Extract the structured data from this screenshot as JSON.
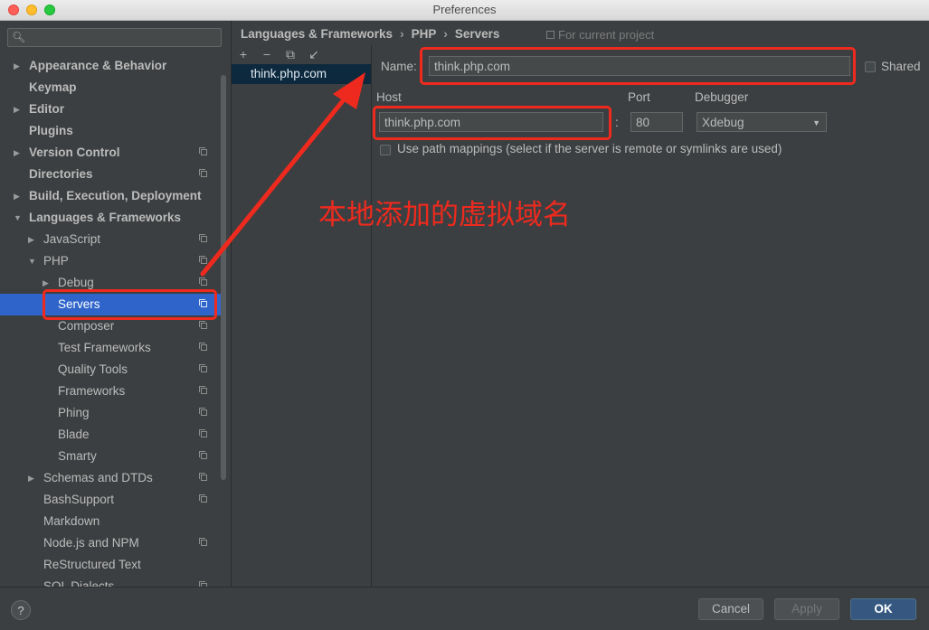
{
  "window": {
    "title": "Preferences"
  },
  "sidebar": {
    "search_placeholder": "",
    "items": [
      {
        "label": "Appearance & Behavior",
        "indent": 0,
        "arrow": "right",
        "bold": true,
        "project_icon": false,
        "selected": false
      },
      {
        "label": "Keymap",
        "indent": 0,
        "arrow": "",
        "bold": true,
        "project_icon": false,
        "selected": false
      },
      {
        "label": "Editor",
        "indent": 0,
        "arrow": "right",
        "bold": true,
        "project_icon": false,
        "selected": false
      },
      {
        "label": "Plugins",
        "indent": 0,
        "arrow": "",
        "bold": true,
        "project_icon": false,
        "selected": false
      },
      {
        "label": "Version Control",
        "indent": 0,
        "arrow": "right",
        "bold": true,
        "project_icon": true,
        "selected": false
      },
      {
        "label": "Directories",
        "indent": 0,
        "arrow": "",
        "bold": true,
        "project_icon": true,
        "selected": false
      },
      {
        "label": "Build, Execution, Deployment",
        "indent": 0,
        "arrow": "right",
        "bold": true,
        "project_icon": false,
        "selected": false
      },
      {
        "label": "Languages & Frameworks",
        "indent": 0,
        "arrow": "down",
        "bold": true,
        "project_icon": false,
        "selected": false
      },
      {
        "label": "JavaScript",
        "indent": 1,
        "arrow": "right",
        "bold": false,
        "project_icon": true,
        "selected": false
      },
      {
        "label": "PHP",
        "indent": 1,
        "arrow": "down",
        "bold": false,
        "project_icon": true,
        "selected": false
      },
      {
        "label": "Debug",
        "indent": 2,
        "arrow": "right",
        "bold": false,
        "project_icon": true,
        "selected": false
      },
      {
        "label": "Servers",
        "indent": 2,
        "arrow": "",
        "bold": false,
        "project_icon": true,
        "selected": true
      },
      {
        "label": "Composer",
        "indent": 2,
        "arrow": "",
        "bold": false,
        "project_icon": true,
        "selected": false
      },
      {
        "label": "Test Frameworks",
        "indent": 2,
        "arrow": "",
        "bold": false,
        "project_icon": true,
        "selected": false
      },
      {
        "label": "Quality Tools",
        "indent": 2,
        "arrow": "",
        "bold": false,
        "project_icon": true,
        "selected": false
      },
      {
        "label": "Frameworks",
        "indent": 2,
        "arrow": "",
        "bold": false,
        "project_icon": true,
        "selected": false
      },
      {
        "label": "Phing",
        "indent": 2,
        "arrow": "",
        "bold": false,
        "project_icon": true,
        "selected": false
      },
      {
        "label": "Blade",
        "indent": 2,
        "arrow": "",
        "bold": false,
        "project_icon": true,
        "selected": false
      },
      {
        "label": "Smarty",
        "indent": 2,
        "arrow": "",
        "bold": false,
        "project_icon": true,
        "selected": false
      },
      {
        "label": "Schemas and DTDs",
        "indent": 1,
        "arrow": "right",
        "bold": false,
        "project_icon": true,
        "selected": false
      },
      {
        "label": "BashSupport",
        "indent": 1,
        "arrow": "",
        "bold": false,
        "project_icon": true,
        "selected": false
      },
      {
        "label": "Markdown",
        "indent": 1,
        "arrow": "",
        "bold": false,
        "project_icon": false,
        "selected": false
      },
      {
        "label": "Node.js and NPM",
        "indent": 1,
        "arrow": "",
        "bold": false,
        "project_icon": true,
        "selected": false
      },
      {
        "label": "ReStructured Text",
        "indent": 1,
        "arrow": "",
        "bold": false,
        "project_icon": false,
        "selected": false
      },
      {
        "label": "SQL Dialects",
        "indent": 1,
        "arrow": "",
        "bold": false,
        "project_icon": true,
        "selected": false
      }
    ]
  },
  "breadcrumb": {
    "items": [
      "Languages & Frameworks",
      "PHP",
      "Servers"
    ],
    "for_project": "For current project"
  },
  "server_list": {
    "toolbar": [
      "+",
      "−",
      "⧉",
      "↙"
    ],
    "items": [
      "think.php.com"
    ]
  },
  "form": {
    "name_label": "Name:",
    "name_value": "think.php.com",
    "shared_label": "Shared",
    "host_label": "Host",
    "host_value": "think.php.com",
    "port_label": "Port",
    "port_value": "80",
    "colon": ":",
    "debugger_label": "Debugger",
    "debugger_value": "Xdebug",
    "path_mappings_label": "Use path mappings (select if the server is remote or symlinks are used)"
  },
  "annotation": {
    "text": "本地添加的虚拟域名",
    "color": "#ee2a1e"
  },
  "footer": {
    "help": "?",
    "cancel": "Cancel",
    "apply": "Apply",
    "ok": "OK"
  },
  "colors": {
    "background": "#3c3f41",
    "selection": "#2f65ca",
    "accent_ok": "#365880"
  }
}
